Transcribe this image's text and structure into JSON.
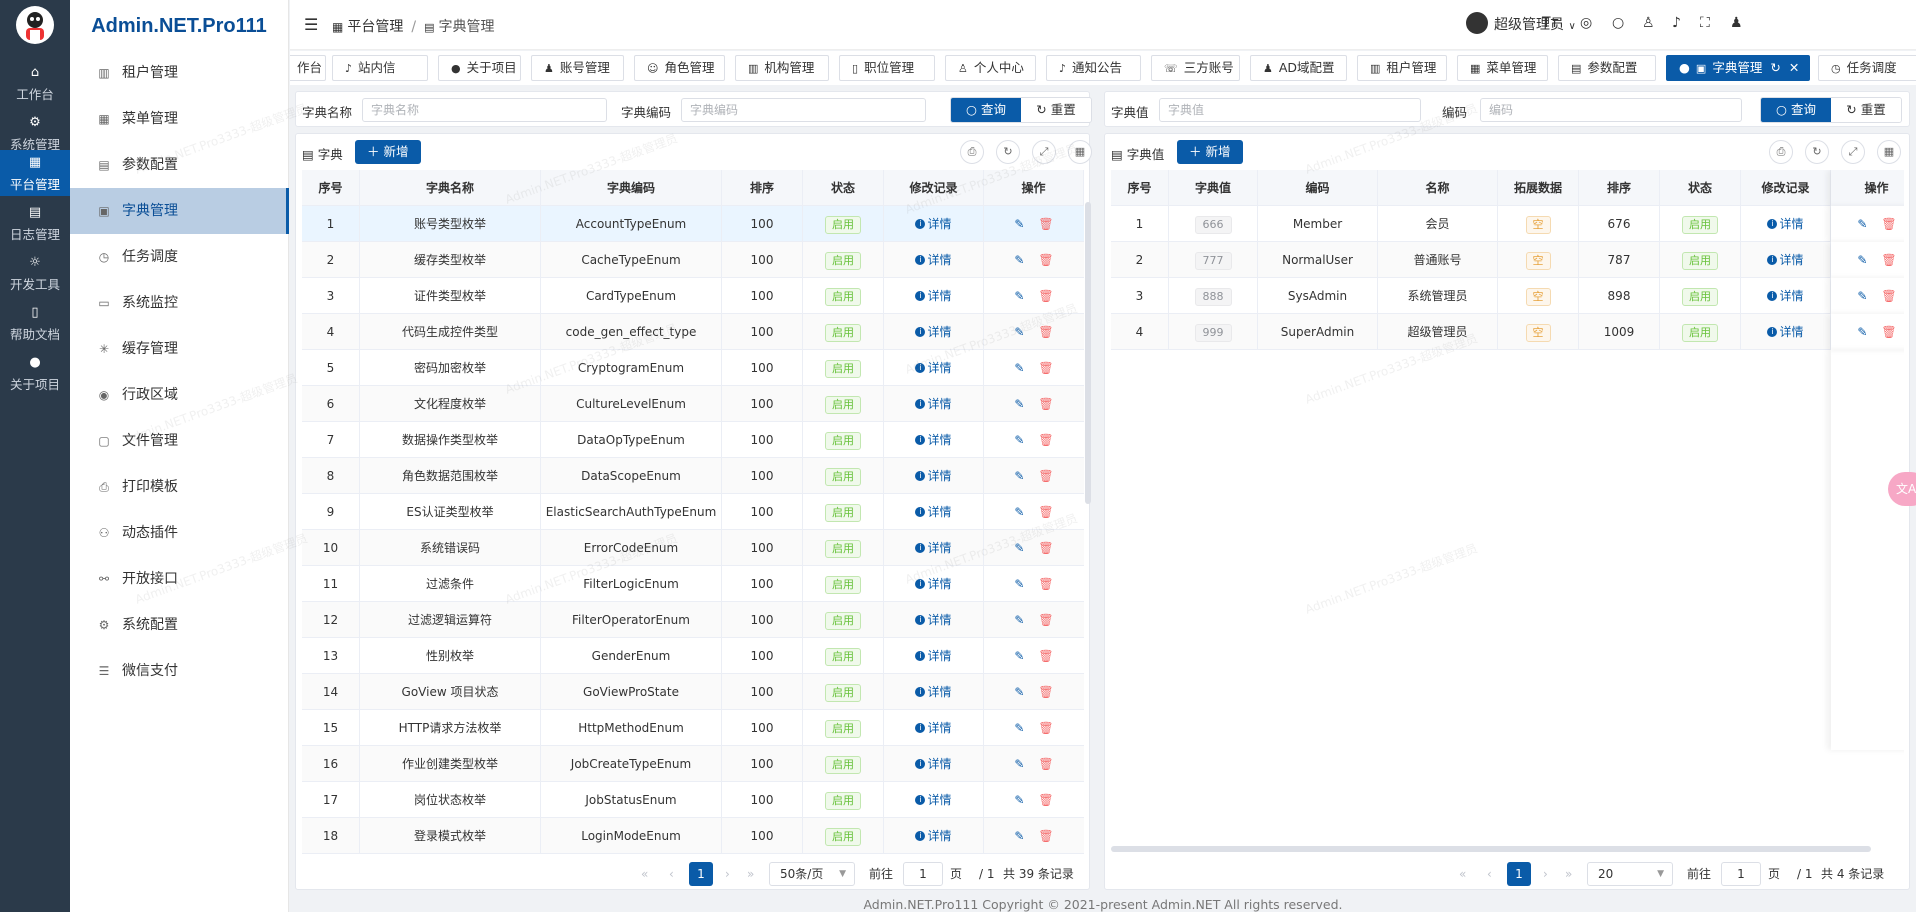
{
  "app": {
    "brand": "Admin.NET.Pro111",
    "footer": "Admin.NET.Pro111 Copyright © 2021-present Admin.NET All rights reserved."
  },
  "rail": [
    {
      "label": "工作台",
      "icon": "home-icon"
    },
    {
      "label": "系统管理",
      "icon": "gear-icon"
    },
    {
      "label": "平台管理",
      "icon": "grid-icon",
      "active": true
    },
    {
      "label": "日志管理",
      "icon": "doc-icon"
    },
    {
      "label": "开发工具",
      "icon": "sun-icon"
    },
    {
      "label": "帮助文档",
      "icon": "book-icon"
    },
    {
      "label": "关于项目",
      "icon": "info-icon"
    }
  ],
  "menu": [
    {
      "label": "租户管理"
    },
    {
      "label": "菜单管理"
    },
    {
      "label": "参数配置"
    },
    {
      "label": "字典管理",
      "active": true
    },
    {
      "label": "任务调度"
    },
    {
      "label": "系统监控"
    },
    {
      "label": "缓存管理"
    },
    {
      "label": "行政区域"
    },
    {
      "label": "文件管理"
    },
    {
      "label": "打印模板"
    },
    {
      "label": "动态插件"
    },
    {
      "label": "开放接口"
    },
    {
      "label": "系统配置"
    },
    {
      "label": "微信支付"
    }
  ],
  "header": {
    "crumb1": "平台管理",
    "crumb2": "字典管理",
    "user": "超级管理员"
  },
  "tabs": [
    {
      "label": "作台"
    },
    {
      "label": "站内信"
    },
    {
      "label": "关于项目"
    },
    {
      "label": "账号管理"
    },
    {
      "label": "角色管理"
    },
    {
      "label": "机构管理"
    },
    {
      "label": "职位管理"
    },
    {
      "label": "个人中心"
    },
    {
      "label": "通知公告"
    },
    {
      "label": "三方账号"
    },
    {
      "label": "AD域配置"
    },
    {
      "label": "租户管理"
    },
    {
      "label": "菜单管理"
    },
    {
      "label": "参数配置"
    },
    {
      "label": "字典管理",
      "active": true
    },
    {
      "label": "任务调度"
    }
  ],
  "left": {
    "filter": {
      "name_label": "字典名称",
      "name_placeholder": "字典名称",
      "code_label": "字典编码",
      "code_placeholder": "字典编码",
      "query": "查询",
      "reset": "重置"
    },
    "title": "字典",
    "add": "新增",
    "columns": [
      "序号",
      "字典名称",
      "字典编码",
      "排序",
      "状态",
      "修改记录",
      "操作"
    ],
    "status_text": "启用",
    "detail_text": "详情",
    "rows": [
      {
        "no": "1",
        "name": "账号类型枚举",
        "code": "AccountTypeEnum",
        "sort": "100"
      },
      {
        "no": "2",
        "name": "缓存类型枚举",
        "code": "CacheTypeEnum",
        "sort": "100"
      },
      {
        "no": "3",
        "name": "证件类型枚举",
        "code": "CardTypeEnum",
        "sort": "100"
      },
      {
        "no": "4",
        "name": "代码生成控件类型",
        "code": "code_gen_effect_type",
        "sort": "100"
      },
      {
        "no": "5",
        "name": "密码加密枚举",
        "code": "CryptogramEnum",
        "sort": "100"
      },
      {
        "no": "6",
        "name": "文化程度枚举",
        "code": "CultureLevelEnum",
        "sort": "100"
      },
      {
        "no": "7",
        "name": "数据操作类型枚举",
        "code": "DataOpTypeEnum",
        "sort": "100"
      },
      {
        "no": "8",
        "name": "角色数据范围枚举",
        "code": "DataScopeEnum",
        "sort": "100"
      },
      {
        "no": "9",
        "name": "ES认证类型枚举",
        "code": "ElasticSearchAuthTypeEnum",
        "sort": "100"
      },
      {
        "no": "10",
        "name": "系统错误码",
        "code": "ErrorCodeEnum",
        "sort": "100"
      },
      {
        "no": "11",
        "name": "过滤条件",
        "code": "FilterLogicEnum",
        "sort": "100"
      },
      {
        "no": "12",
        "name": "过滤逻辑运算符",
        "code": "FilterOperatorEnum",
        "sort": "100"
      },
      {
        "no": "13",
        "name": "性别枚举",
        "code": "GenderEnum",
        "sort": "100"
      },
      {
        "no": "14",
        "name": "GoView 项目状态",
        "code": "GoViewProState",
        "sort": "100"
      },
      {
        "no": "15",
        "name": "HTTP请求方法枚举",
        "code": "HttpMethodEnum",
        "sort": "100"
      },
      {
        "no": "16",
        "name": "作业创建类型枚举",
        "code": "JobCreateTypeEnum",
        "sort": "100"
      },
      {
        "no": "17",
        "name": "岗位状态枚举",
        "code": "JobStatusEnum",
        "sort": "100"
      },
      {
        "no": "18",
        "name": "登录模式枚举",
        "code": "LoginModeEnum",
        "sort": "100"
      }
    ],
    "pager": {
      "current": "1",
      "size": "50条/页",
      "goto": "前往",
      "page_input": "1",
      "page_unit": "页",
      "total_pages": "/ 1",
      "total": "共 39 条记录"
    }
  },
  "right": {
    "filter": {
      "value_label": "字典值",
      "value_placeholder": "字典值",
      "code_label": "编码",
      "code_placeholder": "编码",
      "query": "查询",
      "reset": "重置"
    },
    "title": "字典值",
    "add": "新增",
    "columns": [
      "序号",
      "字典值",
      "编码",
      "名称",
      "拓展数据",
      "排序",
      "状态",
      "修改记录",
      "操作"
    ],
    "status_text": "启用",
    "detail_text": "详情",
    "ext_text": "空",
    "rows": [
      {
        "no": "1",
        "value": "666",
        "code": "Member",
        "name": "会员",
        "sort": "676"
      },
      {
        "no": "2",
        "value": "777",
        "code": "NormalUser",
        "name": "普通账号",
        "sort": "787"
      },
      {
        "no": "3",
        "value": "888",
        "code": "SysAdmin",
        "name": "系统管理员",
        "sort": "898"
      },
      {
        "no": "4",
        "value": "999",
        "code": "SuperAdmin",
        "name": "超级管理员",
        "sort": "1009"
      }
    ],
    "pager": {
      "current": "1",
      "size": "20",
      "goto": "前往",
      "page_input": "1",
      "page_unit": "页",
      "total_pages": "/ 1",
      "total": "共 4 条记录"
    }
  },
  "watermark": "Admin.NET.Pro3333-超级管理员",
  "colors": {
    "primary": "#0a5ba8",
    "rail": "#2b3a4a",
    "success": "#67c23a",
    "danger": "#f56c6c",
    "warning": "#e6a23c"
  }
}
